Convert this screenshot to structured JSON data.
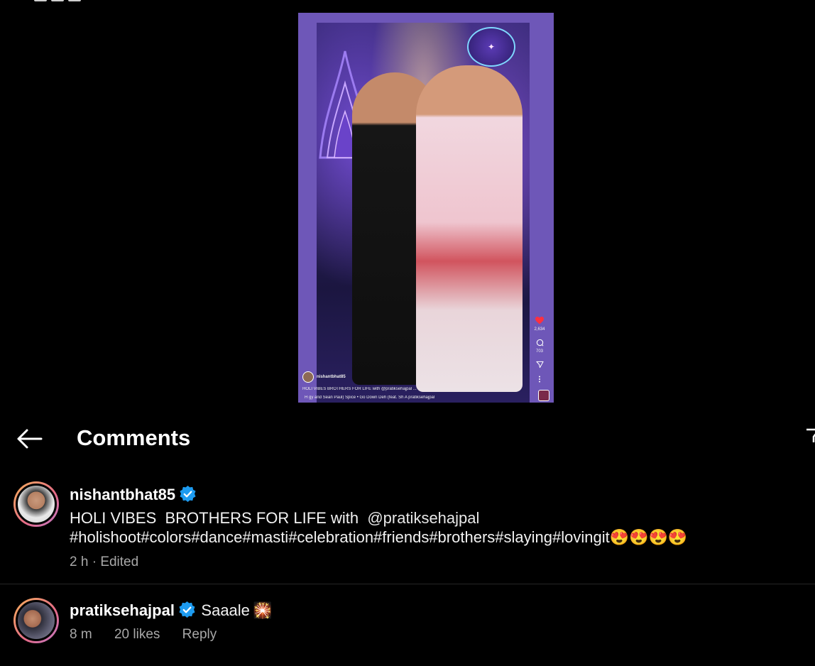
{
  "reel": {
    "author": "nishantbhat85",
    "caption": "HOLI VIBES  BROTHERS FOR LIFE with  @pratiksehajpal ...",
    "music": "H gy and Sean Paul)  Spice • Go Down Deh (feat. Sh  A pratiksehajpal",
    "likes": "2,634",
    "comments": "703"
  },
  "header": {
    "title": "Comments"
  },
  "comments": [
    {
      "username": "nishantbhat85",
      "text_line1_prefix": "HOLI VIBES  BROTHERS FOR LIFE with  ",
      "mention": "@pratiksehajpal",
      "text_line2": "#holishoot#colors#dance#masti#celebration#friends#brothers#slaying#lovingit",
      "emojis": "😍😍😍😍",
      "time": "2 h",
      "edited": "Edited"
    },
    {
      "username": "pratiksehajpal",
      "text": "Saaale",
      "emoji": "🎇",
      "time": "8 m",
      "likes": "20 likes",
      "reply": "Reply"
    }
  ],
  "colors": {
    "background": "#000000",
    "verified": "#1d9bf0",
    "meta": "#a8a8a8"
  }
}
